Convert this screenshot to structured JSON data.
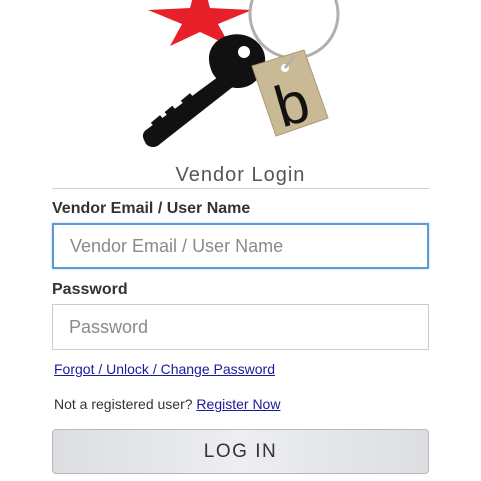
{
  "header": {
    "title": "Vendor Login"
  },
  "form": {
    "email_label": "Vendor Email / User Name",
    "email_placeholder": "Vendor Email / User Name",
    "email_value": "",
    "password_label": "Password",
    "password_placeholder": "Password",
    "password_value": "",
    "forgot_link": "Forgot / Unlock / Change Password",
    "register_prompt": "Not a registered user?",
    "register_link": "Register Now",
    "login_button": "LOG IN"
  },
  "logo": {
    "tag_letter": "b",
    "icon": "key-with-tag-logo",
    "colors": {
      "star": "#e8202a",
      "key": "#111111",
      "tag": "#c9b995",
      "ring": "#b0b0b0"
    }
  },
  "colors": {
    "focus_border": "#5b9bd5",
    "link": "#1a1a9a",
    "button_bg": "#e3e5e8"
  }
}
